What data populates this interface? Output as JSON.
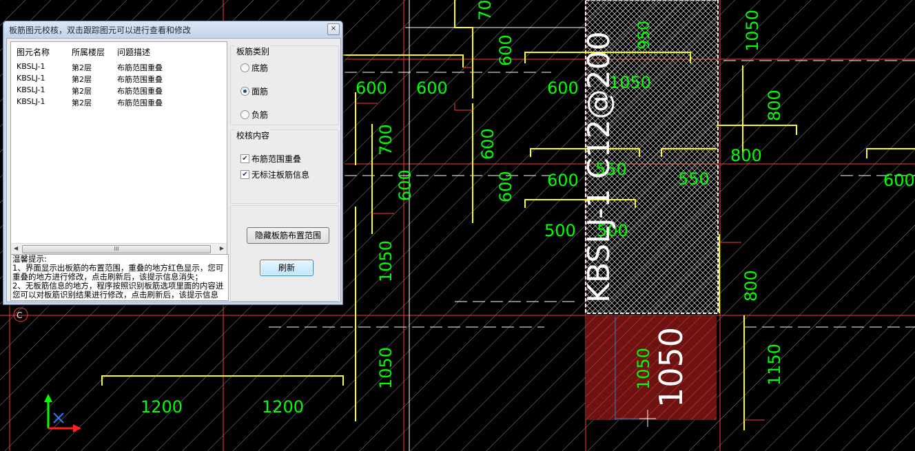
{
  "dialog": {
    "title": "板筋图元校核，双击跟踪图元可以进行查看和修改",
    "close_glyph": "×",
    "list": {
      "headers": [
        "图元名称",
        "所属楼层",
        "问题描述"
      ],
      "rows": [
        [
          "KBSLJ-1",
          "第2层",
          "布筋范围重叠"
        ],
        [
          "KBSLJ-1",
          "第2层",
          "布筋范围重叠"
        ],
        [
          "KBSLJ-1",
          "第2层",
          "布筋范围重叠"
        ],
        [
          "KBSLJ-1",
          "第2层",
          "布筋范围重叠"
        ]
      ]
    },
    "tips": {
      "title": "温馨提示:",
      "lines": [
        "1、界面显示出板筋的布置范围，重叠的地方红色显示，您可",
        "重叠的地方进行修改，点击刷新后，该提示信息消失；",
        "2、无板筋信息的地方，程序按照识别板筋选项里面的内容进",
        "您可以对板筋识别结果进行修改，点击刷新后，该提示信息"
      ]
    },
    "rebar_type": {
      "label": "板筋类别",
      "options": [
        "底筋",
        "面筋",
        "负筋"
      ],
      "selected_index": 1
    },
    "check_content": {
      "label": "校核内容",
      "items": [
        {
          "label": "布筋范围重叠",
          "checked": true
        },
        {
          "label": "无标注板筋信息",
          "checked": true
        }
      ]
    },
    "hide_button": "隐藏板筋布置范围",
    "refresh_button": "刷新"
  },
  "drawing": {
    "dims": [
      "700",
      "600",
      "600",
      "600",
      "600",
      "600",
      "700",
      "600",
      "600",
      "600",
      "600",
      "500",
      "500",
      "1050",
      "1050",
      "1050",
      "800",
      "800",
      "800",
      "1050",
      "1150",
      "1200",
      "1200",
      "950",
      "1050",
      "550",
      "550",
      "1050"
    ],
    "rebar_label": "KBSLJ-1 C12@200",
    "axis_label": "C",
    "scrollbar_glyph": "III"
  },
  "colors": {
    "background": "#000000",
    "dim_text": "#00ff00",
    "rebar_yellow": "#ffff00",
    "axis_red": "#ff3b3b",
    "overlap_red": "#8b1a1a"
  }
}
